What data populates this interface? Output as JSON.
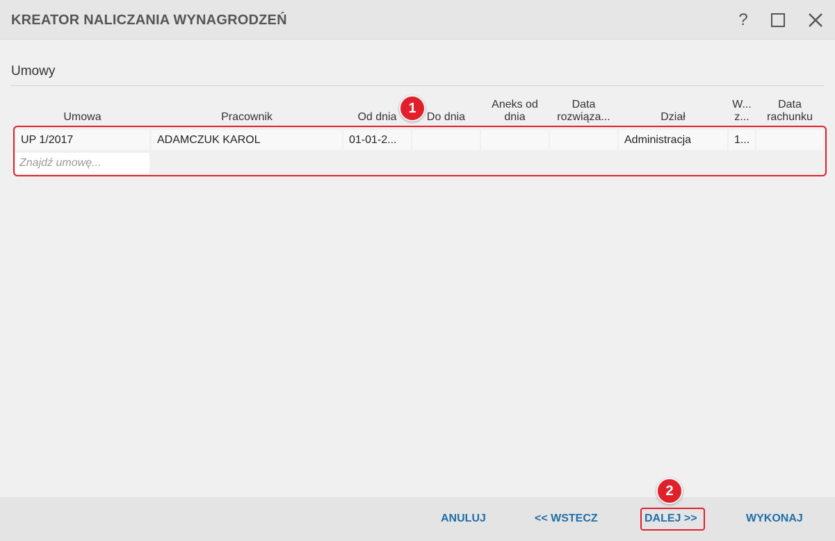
{
  "window": {
    "title": "KREATOR NALICZANIA WYNAGRODZEŃ",
    "help_label": "?"
  },
  "section": {
    "title": "Umowy"
  },
  "columns": [
    {
      "line1": "",
      "line2": "Umowa"
    },
    {
      "line1": "",
      "line2": "Pracownik"
    },
    {
      "line1": "",
      "line2": "Od dnia"
    },
    {
      "line1": "",
      "line2": "Do dnia"
    },
    {
      "line1": "Aneks od",
      "line2": "dnia"
    },
    {
      "line1": "Data",
      "line2": "rozwiąza..."
    },
    {
      "line1": "",
      "line2": "Dział"
    },
    {
      "line1": "W...",
      "line2": "z..."
    },
    {
      "line1": "Data",
      "line2": "rachunku"
    }
  ],
  "rows": [
    [
      "UP 1/2017",
      "ADAMCZUK KAROL",
      "01-01-2...",
      "",
      "",
      "",
      "Administracja",
      "1...",
      ""
    ]
  ],
  "filter": {
    "placeholder": "Znajdź umowę..."
  },
  "badges": {
    "one": "1",
    "two": "2"
  },
  "footer": {
    "cancel": "ANULUJ",
    "back": "<< WSTECZ",
    "next": "DALEJ >>",
    "execute": "WYKONAJ"
  },
  "colors": {
    "accent": "#1f6fa8",
    "highlight": "#e0202a"
  }
}
